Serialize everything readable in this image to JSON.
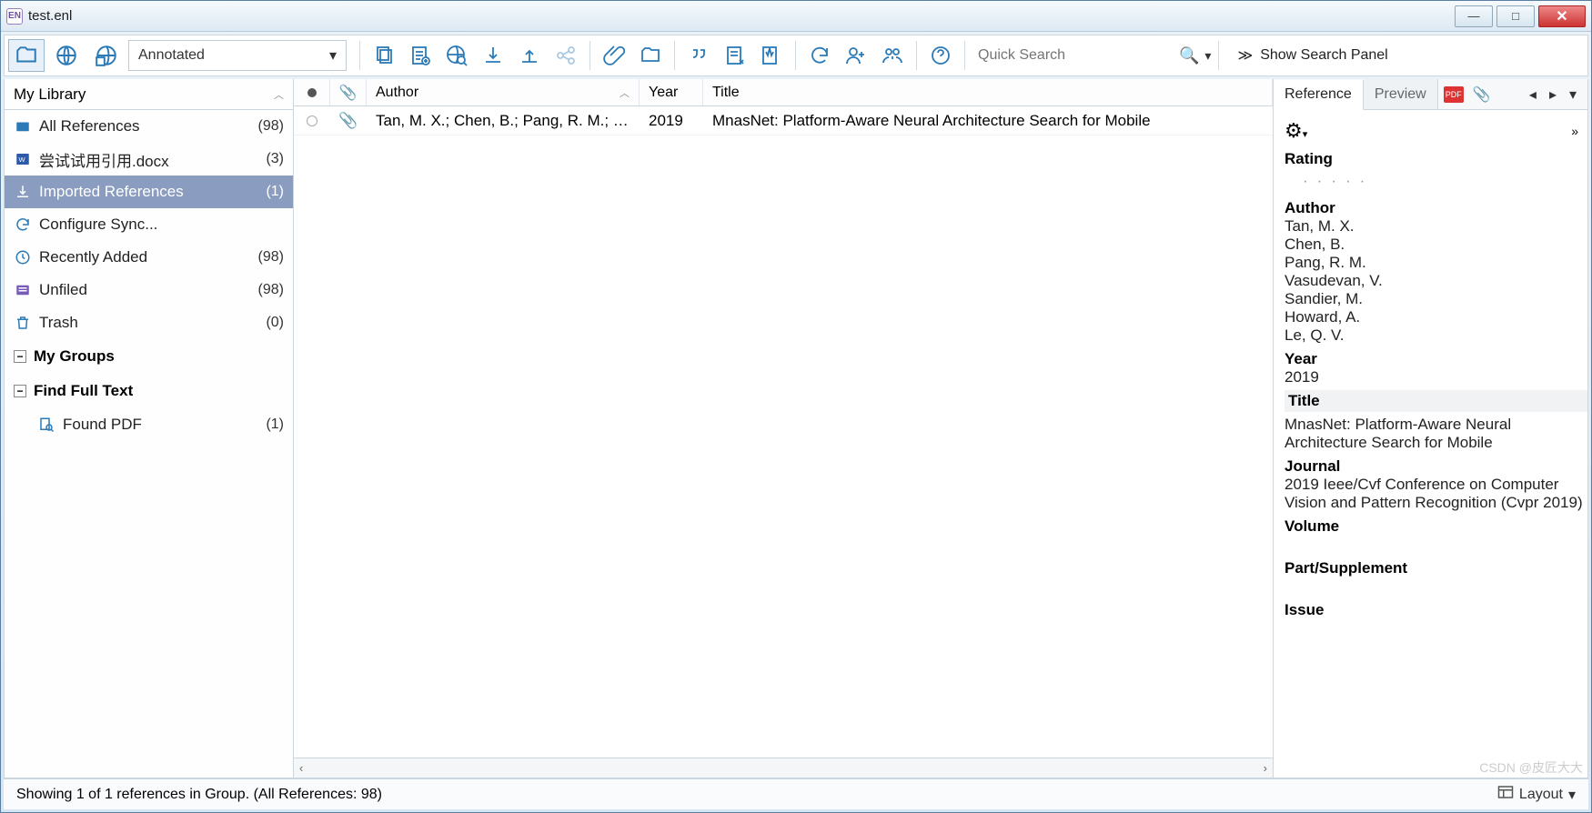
{
  "window": {
    "title": "test.enl"
  },
  "toolbar": {
    "mode_dropdown": "Annotated",
    "search_placeholder": "Quick Search",
    "show_search_panel": "Show Search Panel"
  },
  "sidebar": {
    "header": "My Library",
    "items": [
      {
        "label": "All References",
        "count": "(98)"
      },
      {
        "label": "尝试试用引用.docx",
        "count": "(3)"
      },
      {
        "label": "Imported References",
        "count": "(1)"
      },
      {
        "label": "Configure Sync...",
        "count": ""
      },
      {
        "label": "Recently Added",
        "count": "(98)"
      },
      {
        "label": "Unfiled",
        "count": "(98)"
      },
      {
        "label": "Trash",
        "count": "(0)"
      }
    ],
    "group_my": "My Groups",
    "group_find": "Find Full Text",
    "found_pdf": {
      "label": "Found PDF",
      "count": "(1)"
    }
  },
  "table": {
    "headers": {
      "author": "Author",
      "year": "Year",
      "title": "Title"
    },
    "rows": [
      {
        "author": "Tan, M. X.; Chen, B.; Pang, R. M.; Va...",
        "year": "2019",
        "title": "MnasNet: Platform-Aware Neural Architecture Search for Mobile"
      }
    ]
  },
  "tabs": {
    "reference": "Reference",
    "preview": "Preview"
  },
  "reference": {
    "rating_label": "Rating",
    "author_label": "Author",
    "authors": [
      "Tan, M. X.",
      "Chen, B.",
      "Pang, R. M.",
      "Vasudevan, V.",
      "Sandier, M.",
      "Howard, A.",
      "Le, Q. V."
    ],
    "year_label": "Year",
    "year": "2019",
    "title_label": "Title",
    "title": "MnasNet: Platform-Aware Neural Architecture Search for Mobile",
    "journal_label": "Journal",
    "journal": "2019 Ieee/Cvf Conference on Computer Vision and Pattern Recognition (Cvpr 2019)",
    "volume_label": "Volume",
    "part_label": "Part/Supplement",
    "issue_label": "Issue"
  },
  "statusbar": {
    "text": "Showing 1 of 1 references in Group. (All References: 98)",
    "layout": "Layout"
  },
  "watermark": "CSDN @皮匠大大"
}
